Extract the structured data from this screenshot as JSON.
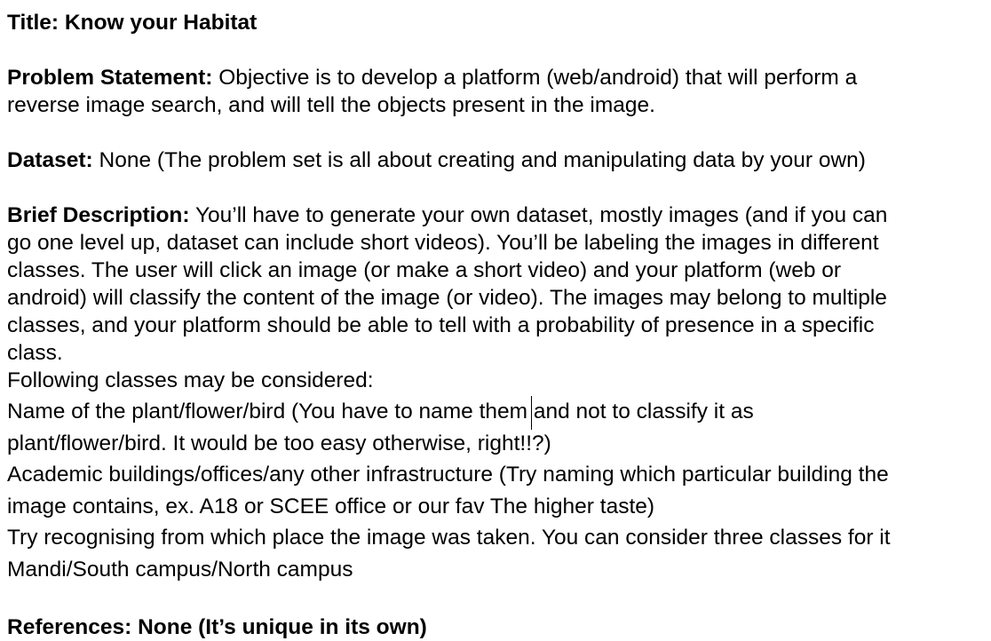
{
  "title": {
    "label": "Title:",
    "text": "Know your Habitat"
  },
  "problem_statement": {
    "label": "Problem Statement:",
    "lines": [
      "Objective is to develop a platform (web/android) that will perform a",
      "reverse image search, and will tell the objects present in the image."
    ]
  },
  "dataset": {
    "label": "Dataset:",
    "text": "None (The problem set is all about creating and manipulating data by your own)"
  },
  "brief_description": {
    "label": "Brief Description:",
    "lines": [
      "You’ll have to generate your own dataset, mostly images (and if you can",
      "go one level up, dataset can include short videos). You’ll be labeling the images in different",
      "classes. The user will click an image (or make a short video) and your platform (web or",
      "android) will classify the content of the image (or video). The images may belong to multiple",
      "classes, and your platform should be able to tell with a probability of presence in a specific",
      "class."
    ]
  },
  "classes_intro": "Following classes may be considered:",
  "class_lines": [
    "Name of the plant/flower/bird (You have to name them and not to classify it as",
    "plant/flower/bird. It would be too easy otherwise, right!!?)",
    "Academic buildings/offices/any other infrastructure (Try naming which particular building the",
    "image contains, ex. A18 or SCEE office or our fav The higher taste)",
    "Try recognising from which place the image was taken. You can consider three classes for it",
    "Mandi/South campus/North campus"
  ],
  "references": {
    "label": "References:",
    "text": "None (It’s unique in its own)"
  }
}
